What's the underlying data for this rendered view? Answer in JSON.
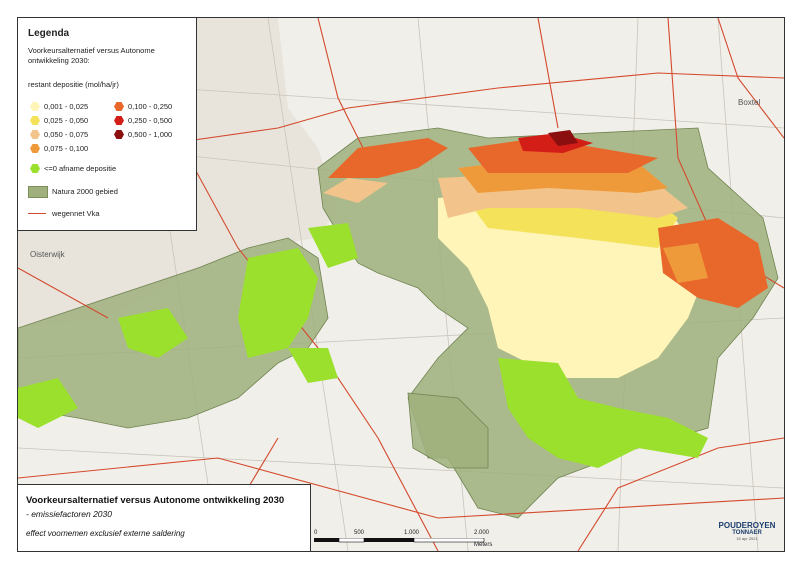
{
  "legend": {
    "title": "Legenda",
    "subtitle": "Voorkeursalternatief versus Autonome ontwikkeling 2030:",
    "range_title": "restant depositie (mol/ha/jr)",
    "classes": [
      {
        "label": "0,001 - 0,025",
        "color": "#fff5b8"
      },
      {
        "label": "0,025 - 0,050",
        "color": "#f3e25a"
      },
      {
        "label": "0,050 - 0,075",
        "color": "#f2c48b"
      },
      {
        "label": "0,075 - 0,100",
        "color": "#ef9a3a"
      },
      {
        "label": "0,100 - 0,250",
        "color": "#e8672a"
      },
      {
        "label": "0,250 - 0,500",
        "color": "#d21e17"
      },
      {
        "label": "0,500 - 1,000",
        "color": "#8b0f0f"
      }
    ],
    "afname": {
      "label": "<=0 afname depositie",
      "color": "#9be02c"
    },
    "natura": {
      "label": "Natura 2000 gebied",
      "color": "#9fb07c"
    },
    "wegennet": {
      "label": "wegennet Vka",
      "color": "#d44a2e"
    }
  },
  "map": {
    "towns": [
      "Oisterwijk",
      "Boxtel"
    ]
  },
  "title_block": {
    "line1": "Voorkeursalternatief versus Autonome ontwikkeling 2030",
    "line2": "- emissiefactoren 2030",
    "line3": "effect voornemen exclusief externe saldering"
  },
  "scale": {
    "ticks": [
      "0",
      "500",
      "1.000",
      "2.000"
    ],
    "unit": "Meters"
  },
  "logo": {
    "name": "POUDEROYEN",
    "name2": "TONNAER",
    "date": "15 apr 2021"
  }
}
